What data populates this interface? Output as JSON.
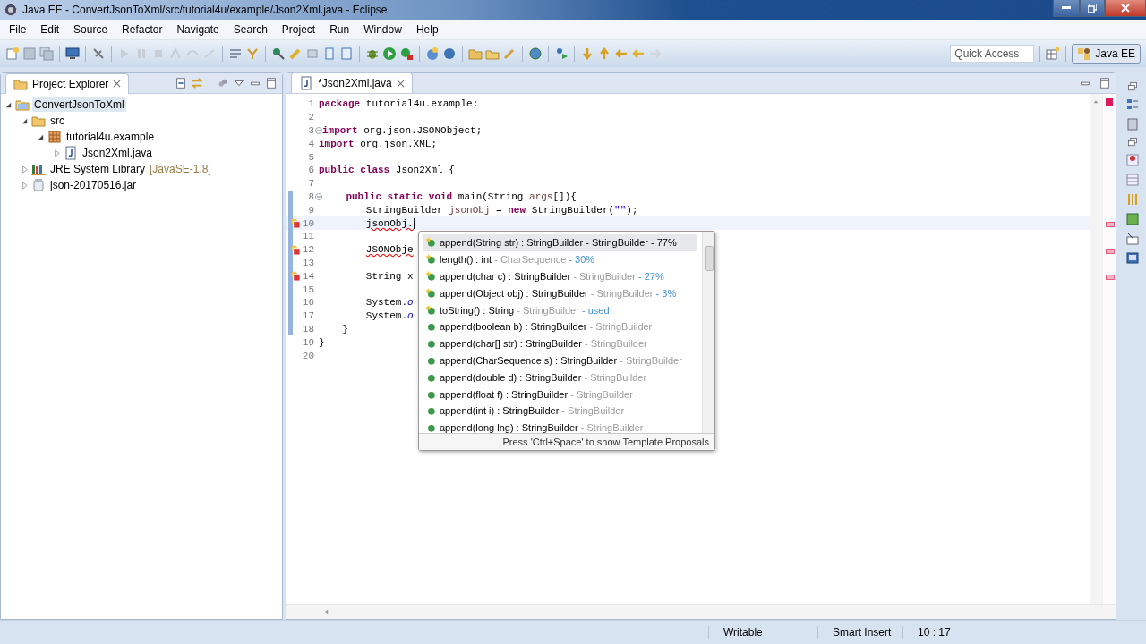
{
  "window": {
    "title": "Java EE - ConvertJsonToXml/src/tutorial4u/example/Json2Xml.java - Eclipse"
  },
  "menu": [
    "File",
    "Edit",
    "Source",
    "Refactor",
    "Navigate",
    "Search",
    "Project",
    "Run",
    "Window",
    "Help"
  ],
  "toolbar": {
    "quick_access": {
      "placeholder": "Quick Access"
    },
    "perspective": {
      "label": "Java EE",
      "selected": true
    }
  },
  "project_explorer": {
    "title": "Project Explorer",
    "tree": [
      {
        "label": "ConvertJsonToXml",
        "kind": "project",
        "expanded": true,
        "selected": true,
        "children": [
          {
            "label": "src",
            "kind": "folder",
            "expanded": true,
            "selected": false,
            "children": [
              {
                "label": "tutorial4u.example",
                "kind": "package",
                "expanded": true,
                "selected": false,
                "children": [
                  {
                    "label": "Json2Xml.java",
                    "kind": "file",
                    "expanded": false,
                    "selected": false
                  }
                ]
              }
            ]
          },
          {
            "label": "JRE System Library",
            "decoration": "[JavaSE-1.8]",
            "kind": "library",
            "expanded": false,
            "selected": false
          },
          {
            "label": "json-20170516.jar",
            "kind": "jar",
            "expanded": false,
            "selected": false
          }
        ]
      }
    ]
  },
  "editor": {
    "tab": {
      "title": "*Json2Xml.java",
      "selected": true
    },
    "lines": [
      {
        "number": "1",
        "foldable": false,
        "changed": false,
        "error": false,
        "current": false,
        "tokens": [
          {
            "text": "package",
            "kind": "keyword"
          },
          {
            "text": " tutorial4u.example;",
            "kind": "plain"
          }
        ]
      },
      {
        "number": "2",
        "foldable": false,
        "changed": false,
        "error": false,
        "current": false
      },
      {
        "number": "3",
        "foldable": true,
        "changed": false,
        "error": false,
        "current": false,
        "tokens": [
          {
            "text": "import",
            "kind": "keyword"
          },
          {
            "text": " org.json.JSONObject;",
            "kind": "plain"
          }
        ]
      },
      {
        "number": "4",
        "foldable": false,
        "changed": false,
        "error": false,
        "current": false,
        "tokens": [
          {
            "text": "import",
            "kind": "keyword"
          },
          {
            "text": " org.json.XML;",
            "kind": "plain"
          }
        ]
      },
      {
        "number": "5",
        "foldable": false,
        "changed": false,
        "error": false,
        "current": false
      },
      {
        "number": "6",
        "foldable": false,
        "changed": false,
        "error": false,
        "current": false,
        "tokens": [
          {
            "text": "public class",
            "kind": "keyword"
          },
          {
            "text": " Json2Xml {",
            "kind": "plain"
          }
        ]
      },
      {
        "number": "7",
        "foldable": false,
        "changed": false,
        "error": false,
        "current": false
      },
      {
        "number": "8",
        "foldable": true,
        "changed": true,
        "error": false,
        "current": false,
        "tokens": [
          {
            "text": "    public static void",
            "kind": "keyword"
          },
          {
            "text": " main(String ",
            "kind": "plain"
          },
          {
            "text": "args",
            "kind": "local"
          },
          {
            "text": "[]){",
            "kind": "plain"
          }
        ]
      },
      {
        "number": "9",
        "foldable": false,
        "changed": true,
        "error": false,
        "current": false,
        "tokens": [
          {
            "text": "        StringBuilder ",
            "kind": "plain"
          },
          {
            "text": "jsonObj",
            "kind": "local"
          },
          {
            "text": " = ",
            "kind": "plain"
          },
          {
            "text": "new",
            "kind": "keyword"
          },
          {
            "text": " StringBuilder(",
            "kind": "plain"
          },
          {
            "text": "\"\"",
            "kind": "string"
          },
          {
            "text": ");",
            "kind": "plain"
          }
        ]
      },
      {
        "number": "10",
        "foldable": false,
        "changed": true,
        "error": true,
        "current": true,
        "tokens": [
          {
            "text": "        jsonObj.",
            "kind": "error"
          }
        ]
      },
      {
        "number": "11",
        "foldable": false,
        "changed": true,
        "error": false,
        "current": false
      },
      {
        "number": "12",
        "foldable": false,
        "changed": true,
        "error": true,
        "current": false,
        "tokens": [
          {
            "text": "        JSONObje",
            "kind": "error"
          }
        ]
      },
      {
        "number": "13",
        "foldable": false,
        "changed": true,
        "error": false,
        "current": false
      },
      {
        "number": "14",
        "foldable": false,
        "changed": true,
        "error": true,
        "current": false,
        "tokens": [
          {
            "text": "        String x",
            "kind": "plain"
          }
        ]
      },
      {
        "number": "15",
        "foldable": false,
        "changed": true,
        "error": false,
        "current": false
      },
      {
        "number": "16",
        "foldable": false,
        "changed": true,
        "error": false,
        "current": false,
        "tokens": [
          {
            "text": "        System.",
            "kind": "plain"
          },
          {
            "text": "o",
            "kind": "field"
          }
        ]
      },
      {
        "number": "17",
        "foldable": false,
        "changed": true,
        "error": false,
        "current": false,
        "tokens": [
          {
            "text": "        System.",
            "kind": "plain"
          },
          {
            "text": "o",
            "kind": "field"
          }
        ]
      },
      {
        "number": "18",
        "foldable": false,
        "changed": true,
        "error": false,
        "current": false,
        "tokens": [
          {
            "text": "    }",
            "kind": "plain"
          }
        ]
      },
      {
        "number": "19",
        "foldable": false,
        "changed": false,
        "error": false,
        "current": false,
        "tokens": [
          {
            "text": "}",
            "kind": "plain"
          }
        ]
      },
      {
        "number": "20",
        "foldable": false,
        "changed": false,
        "error": false,
        "current": false
      }
    ],
    "completion": {
      "items": [
        {
          "signature": "append(String str) : StringBuilder",
          "owner": "- StringBuilder",
          "relevance": "- 77%",
          "recommended": true,
          "selected": true
        },
        {
          "signature": "length() : int",
          "owner": "- CharSequence",
          "relevance": "- 30%",
          "recommended": true,
          "selected": false
        },
        {
          "signature": "append(char c) : StringBuilder",
          "owner": "- StringBuilder",
          "relevance": "- 27%",
          "recommended": true,
          "selected": false
        },
        {
          "signature": "append(Object obj) : StringBuilder",
          "owner": "- StringBuilder",
          "relevance": "- 3%",
          "recommended": true,
          "selected": false
        },
        {
          "signature": "toString() : String",
          "owner": "- StringBuilder",
          "relevance": "- used",
          "recommended": true,
          "selected": false
        },
        {
          "signature": "append(boolean b) : StringBuilder",
          "owner": "- StringBuilder",
          "recommended": false,
          "selected": false
        },
        {
          "signature": "append(char[] str) : StringBuilder",
          "owner": "- StringBuilder",
          "recommended": false,
          "selected": false
        },
        {
          "signature": "append(CharSequence s) : StringBuilder",
          "owner": "- StringBuilder",
          "recommended": false,
          "selected": false
        },
        {
          "signature": "append(double d) : StringBuilder",
          "owner": "- StringBuilder",
          "recommended": false,
          "selected": false
        },
        {
          "signature": "append(float f) : StringBuilder",
          "owner": "- StringBuilder",
          "recommended": false,
          "selected": false
        },
        {
          "signature": "append(int i) : StringBuilder",
          "owner": "- StringBuilder",
          "recommended": false,
          "selected": false
        },
        {
          "signature": "append(long lng) : StringBuilder",
          "owner": "- StringBuilder",
          "recommended": false,
          "selected": false
        }
      ],
      "footer": "Press 'Ctrl+Space' to show Template Proposals"
    }
  },
  "status_bar": [
    "Writable",
    "Smart Insert",
    "10 : 17"
  ]
}
